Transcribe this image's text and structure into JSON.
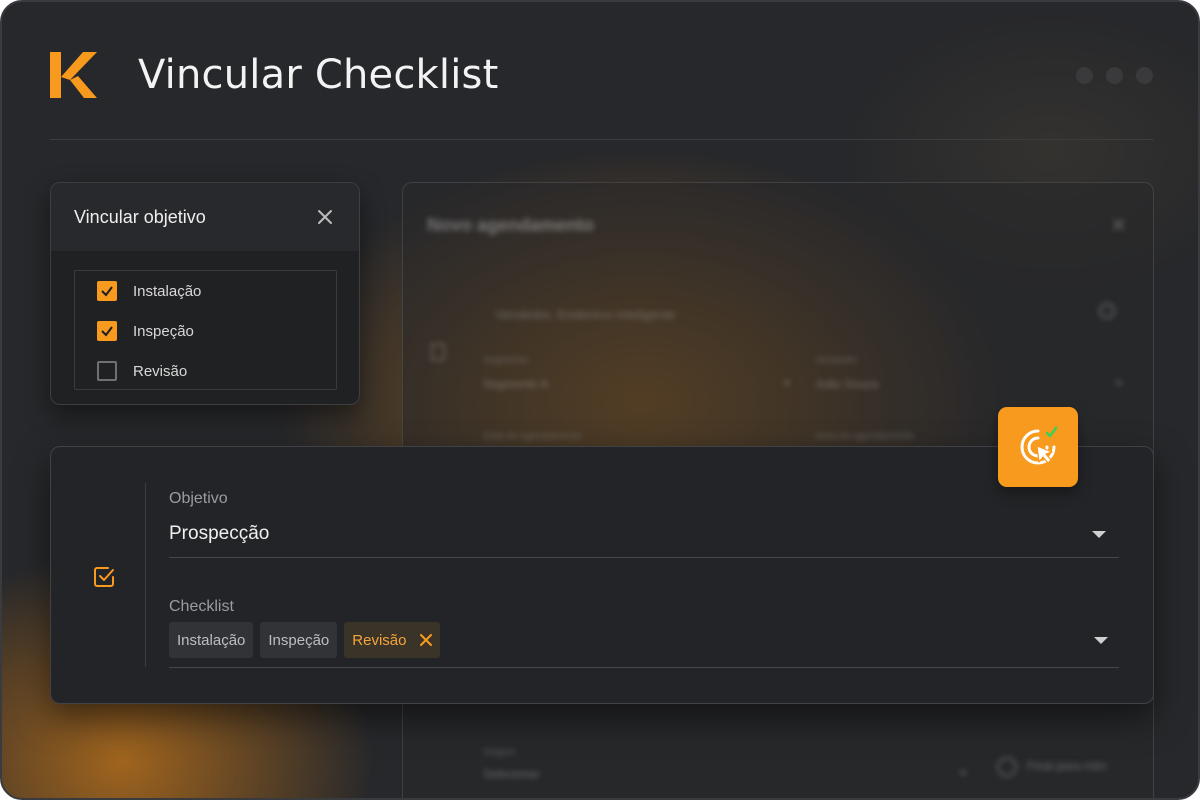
{
  "app": {
    "title": "Vincular Checklist",
    "logo_icon": "k-logo-icon",
    "accent_color": "#f79a1e"
  },
  "background_form": {
    "title": "Novo agendamento",
    "search_placeholder": "Vendedor, Endereco inteligente",
    "field1_label": "Segmento",
    "field1_value": "Segmento A",
    "field2_label": "Vendedor",
    "field2_value": "João Souza",
    "field3_label": "Data do agendamento",
    "field4_label": "Hora do agendamento",
    "field5_label": "Origem",
    "field5_value": "Selecionar",
    "toggle_label": "Final para mim"
  },
  "objective_popup": {
    "title": "Vincular objetivo",
    "items": [
      {
        "label": "Instalação",
        "checked": true
      },
      {
        "label": "Inspeção",
        "checked": true
      },
      {
        "label": "Revisão",
        "checked": false
      }
    ]
  },
  "main_form": {
    "objective_label": "Objetivo",
    "objective_value": "Prospecção",
    "checklist_label": "Checklist",
    "checklist_chips": [
      {
        "label": "Instalação",
        "active": false
      },
      {
        "label": "Inspeção",
        "active": false
      },
      {
        "label": "Revisão",
        "active": true
      }
    ]
  },
  "badge_icon": "cursor-click-check-icon"
}
